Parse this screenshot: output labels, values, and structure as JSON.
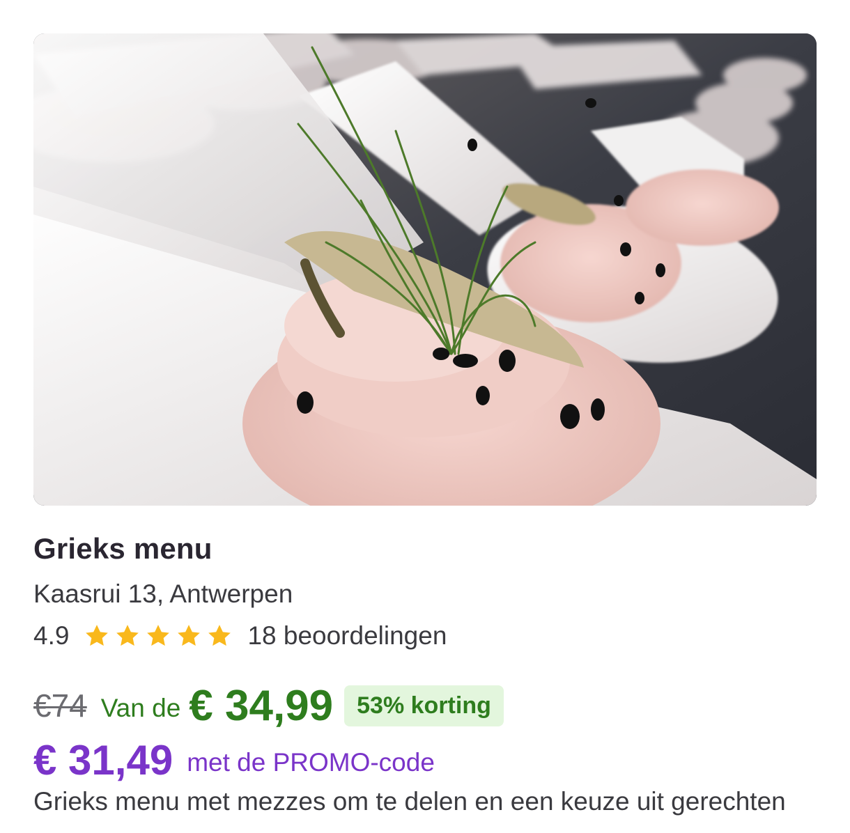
{
  "deal": {
    "image_alt": "food-photo",
    "title": "Grieks menu",
    "address": "Kaasrui 13, Antwerpen",
    "rating": "4.9",
    "stars": 5,
    "reviews": "18 beoordelingen",
    "old_price": "€74",
    "from_label": "Van de",
    "price": "€ 34,99",
    "discount": "53% korting",
    "promo_price": "€ 31,49",
    "promo_label": "met de PROMO-code",
    "description": "Grieks menu met mezzes om te delen en een keuze uit gerechten"
  },
  "colors": {
    "deal_green": "#2e7d1e",
    "badge_bg": "#e3f6dd",
    "promo_purple": "#7a34c9",
    "star_gold": "#f9b81c"
  }
}
